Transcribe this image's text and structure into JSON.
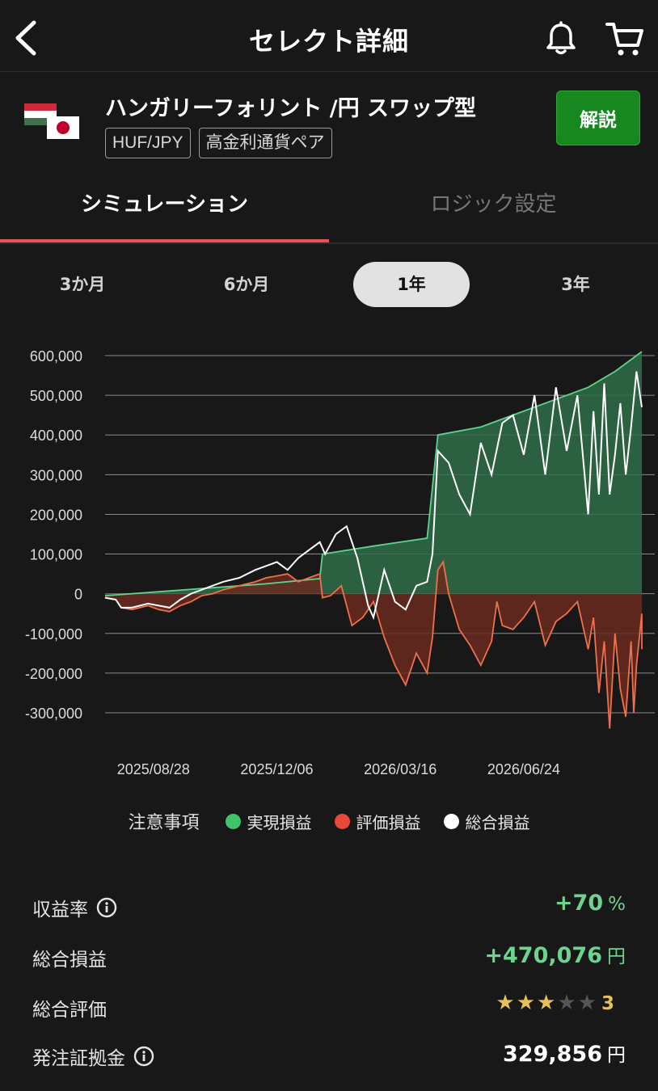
{
  "nav": {
    "title": "セレクト詳細",
    "back_icon": "chevron-left-icon",
    "bell_icon": "bell-icon",
    "cart_icon": "cart-icon"
  },
  "product": {
    "name": "ハンガリーフォリント /円 スワップ型",
    "tags": [
      "HUF/JPY",
      "高金利通貨ペア"
    ],
    "explain_label": "解説",
    "flags": [
      "hungary-flag",
      "japan-flag"
    ]
  },
  "tabs": [
    {
      "label": "シミュレーション",
      "active": true
    },
    {
      "label": "ロジック設定",
      "active": false
    }
  ],
  "periods": [
    {
      "label": "3か月",
      "selected": false
    },
    {
      "label": "6か月",
      "selected": false
    },
    {
      "label": "1年",
      "selected": true
    },
    {
      "label": "3年",
      "selected": false
    }
  ],
  "chart_data": {
    "type": "area",
    "y_ticks": [
      "600,000",
      "500,000",
      "400,000",
      "300,000",
      "200,000",
      "100,000",
      "0",
      "-100,000",
      "-200,000",
      "-300,000"
    ],
    "ylim": [
      -300000,
      600000
    ],
    "x_tick_labels": [
      "2025/08/28",
      "2025/12/06",
      "2026/03/16",
      "2026/06/24"
    ],
    "x_ticks_t": [
      0.09,
      0.32,
      0.55,
      0.78
    ],
    "grid": true,
    "colors": {
      "realized": "#5ed290",
      "unrealized": "#f0704c",
      "total": "#ffffff",
      "realized_fill": "#2f6e49",
      "unrealized_fill": "#6a2a20"
    },
    "series": [
      {
        "name": "実現損益",
        "points": [
          [
            0,
            -5000
          ],
          [
            0.1,
            5000
          ],
          [
            0.2,
            15000
          ],
          [
            0.3,
            25000
          ],
          [
            0.4,
            38000
          ],
          [
            0.405,
            100000
          ],
          [
            0.5,
            120000
          ],
          [
            0.6,
            140000
          ],
          [
            0.62,
            400000
          ],
          [
            0.7,
            420000
          ],
          [
            0.8,
            470000
          ],
          [
            0.9,
            520000
          ],
          [
            0.95,
            560000
          ],
          [
            1.0,
            610000
          ]
        ]
      },
      {
        "name": "評価損益",
        "points": [
          [
            0,
            -10000
          ],
          [
            0.02,
            -15000
          ],
          [
            0.03,
            -35000
          ],
          [
            0.05,
            -40000
          ],
          [
            0.08,
            -30000
          ],
          [
            0.1,
            -40000
          ],
          [
            0.12,
            -45000
          ],
          [
            0.14,
            -30000
          ],
          [
            0.16,
            -20000
          ],
          [
            0.18,
            -5000
          ],
          [
            0.2,
            0
          ],
          [
            0.22,
            10000
          ],
          [
            0.25,
            20000
          ],
          [
            0.28,
            30000
          ],
          [
            0.3,
            40000
          ],
          [
            0.32,
            45000
          ],
          [
            0.34,
            50000
          ],
          [
            0.36,
            30000
          ],
          [
            0.38,
            40000
          ],
          [
            0.4,
            50000
          ],
          [
            0.405,
            -10000
          ],
          [
            0.42,
            -5000
          ],
          [
            0.44,
            20000
          ],
          [
            0.46,
            -80000
          ],
          [
            0.48,
            -60000
          ],
          [
            0.5,
            -20000
          ],
          [
            0.52,
            -110000
          ],
          [
            0.54,
            -180000
          ],
          [
            0.56,
            -230000
          ],
          [
            0.58,
            -150000
          ],
          [
            0.6,
            -200000
          ],
          [
            0.61,
            -110000
          ],
          [
            0.62,
            60000
          ],
          [
            0.63,
            80000
          ],
          [
            0.64,
            0
          ],
          [
            0.66,
            -90000
          ],
          [
            0.68,
            -130000
          ],
          [
            0.7,
            -180000
          ],
          [
            0.72,
            -120000
          ],
          [
            0.73,
            -20000
          ],
          [
            0.74,
            -80000
          ],
          [
            0.76,
            -90000
          ],
          [
            0.78,
            -60000
          ],
          [
            0.8,
            -20000
          ],
          [
            0.82,
            -130000
          ],
          [
            0.84,
            -70000
          ],
          [
            0.86,
            -50000
          ],
          [
            0.88,
            -20000
          ],
          [
            0.9,
            -140000
          ],
          [
            0.91,
            -60000
          ],
          [
            0.92,
            -250000
          ],
          [
            0.93,
            -120000
          ],
          [
            0.94,
            -340000
          ],
          [
            0.95,
            -100000
          ],
          [
            0.96,
            -240000
          ],
          [
            0.97,
            -310000
          ],
          [
            0.98,
            -120000
          ],
          [
            0.985,
            -300000
          ],
          [
            0.99,
            -180000
          ],
          [
            1.0,
            -50000
          ],
          [
            1.0,
            -140000
          ]
        ]
      },
      {
        "name": "総合損益",
        "points": [
          [
            0,
            -10000
          ],
          [
            0.02,
            -15000
          ],
          [
            0.03,
            -35000
          ],
          [
            0.05,
            -35000
          ],
          [
            0.08,
            -25000
          ],
          [
            0.1,
            -30000
          ],
          [
            0.12,
            -35000
          ],
          [
            0.14,
            -15000
          ],
          [
            0.16,
            0
          ],
          [
            0.18,
            10000
          ],
          [
            0.2,
            20000
          ],
          [
            0.22,
            30000
          ],
          [
            0.25,
            40000
          ],
          [
            0.28,
            60000
          ],
          [
            0.3,
            70000
          ],
          [
            0.32,
            80000
          ],
          [
            0.34,
            60000
          ],
          [
            0.36,
            90000
          ],
          [
            0.38,
            110000
          ],
          [
            0.4,
            130000
          ],
          [
            0.41,
            100000
          ],
          [
            0.43,
            150000
          ],
          [
            0.45,
            170000
          ],
          [
            0.47,
            90000
          ],
          [
            0.49,
            -30000
          ],
          [
            0.5,
            -60000
          ],
          [
            0.52,
            60000
          ],
          [
            0.54,
            -20000
          ],
          [
            0.56,
            -40000
          ],
          [
            0.58,
            20000
          ],
          [
            0.6,
            30000
          ],
          [
            0.61,
            100000
          ],
          [
            0.62,
            360000
          ],
          [
            0.64,
            330000
          ],
          [
            0.66,
            250000
          ],
          [
            0.68,
            200000
          ],
          [
            0.7,
            380000
          ],
          [
            0.72,
            300000
          ],
          [
            0.74,
            430000
          ],
          [
            0.76,
            450000
          ],
          [
            0.78,
            350000
          ],
          [
            0.8,
            500000
          ],
          [
            0.82,
            300000
          ],
          [
            0.84,
            520000
          ],
          [
            0.86,
            360000
          ],
          [
            0.88,
            500000
          ],
          [
            0.9,
            200000
          ],
          [
            0.91,
            460000
          ],
          [
            0.92,
            250000
          ],
          [
            0.93,
            530000
          ],
          [
            0.94,
            250000
          ],
          [
            0.95,
            350000
          ],
          [
            0.96,
            480000
          ],
          [
            0.97,
            300000
          ],
          [
            0.98,
            420000
          ],
          [
            0.99,
            560000
          ],
          [
            1.0,
            470000
          ]
        ]
      }
    ]
  },
  "legend": {
    "notes_label": "注意事項",
    "items": [
      {
        "label": "実現損益",
        "color": "#3fc46a"
      },
      {
        "label": "評価損益",
        "color": "#e8483a"
      },
      {
        "label": "総合損益",
        "color": "#ffffff"
      }
    ]
  },
  "stats": {
    "return_rate": {
      "label": "収益率",
      "value": "+70",
      "unit": "%"
    },
    "total_pl": {
      "label": "総合損益",
      "value": "+470,076",
      "unit": "円"
    },
    "rating": {
      "label": "総合評価",
      "value": "3",
      "stars_filled": 3,
      "stars_total": 5,
      "star_color": "#e6c15a",
      "empty_star_color": "#555555"
    },
    "margin": {
      "label": "発注証拠金",
      "value": "329,856",
      "unit": "円"
    }
  }
}
